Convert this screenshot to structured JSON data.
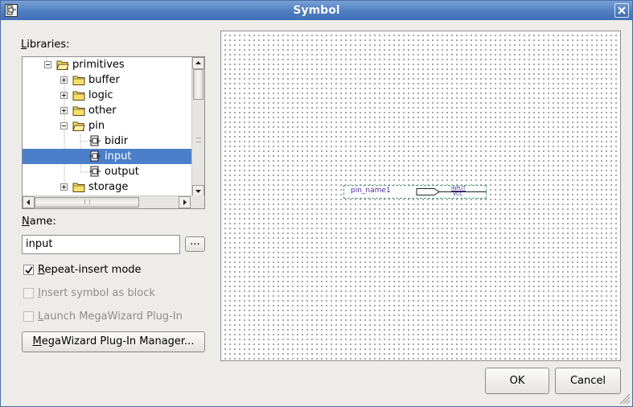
{
  "window": {
    "title": "Symbol"
  },
  "libraries": {
    "label_access": "L",
    "label_rest": "ibraries:",
    "items": [
      {
        "label": "primitives",
        "icon": "folder-open-icon",
        "expanded": true
      },
      {
        "label": "buffer",
        "icon": "folder-icon",
        "expanded": false
      },
      {
        "label": "logic",
        "icon": "folder-icon",
        "expanded": false
      },
      {
        "label": "other",
        "icon": "folder-icon",
        "expanded": false
      },
      {
        "label": "pin",
        "icon": "folder-open-icon",
        "expanded": true
      },
      {
        "label": "bidir",
        "icon": "pin-symbol-icon"
      },
      {
        "label": "input",
        "icon": "pin-symbol-icon",
        "selected": true
      },
      {
        "label": "output",
        "icon": "pin-symbol-icon"
      },
      {
        "label": "storage",
        "icon": "folder-icon",
        "expanded": false
      }
    ]
  },
  "name": {
    "label_access": "N",
    "label_rest": "ame:",
    "value": "input",
    "browse_label": "..."
  },
  "options": {
    "repeat_insert": {
      "access": "R",
      "rest": "epeat-insert mode",
      "checked": true,
      "enabled": true
    },
    "insert_as_block": {
      "access": "I",
      "rest": "nsert symbol as block",
      "checked": false,
      "enabled": false
    },
    "launch_megawizard": {
      "access": "L",
      "rest": "aunch MegaWizard Plug-In",
      "checked": false,
      "enabled": false
    }
  },
  "megawizard_button": {
    "access": "M",
    "rest": "egaWizard Plug-In Manager..."
  },
  "preview": {
    "pin_name": "pin_name1",
    "pin_type": "INPUT",
    "pin_default": "VCC"
  },
  "buttons": {
    "ok": "OK",
    "cancel": "Cancel"
  },
  "colors": {
    "titlebar": "#4f7ec2",
    "selection": "#4b7fc9",
    "pin_text": "#4f2a9a"
  }
}
